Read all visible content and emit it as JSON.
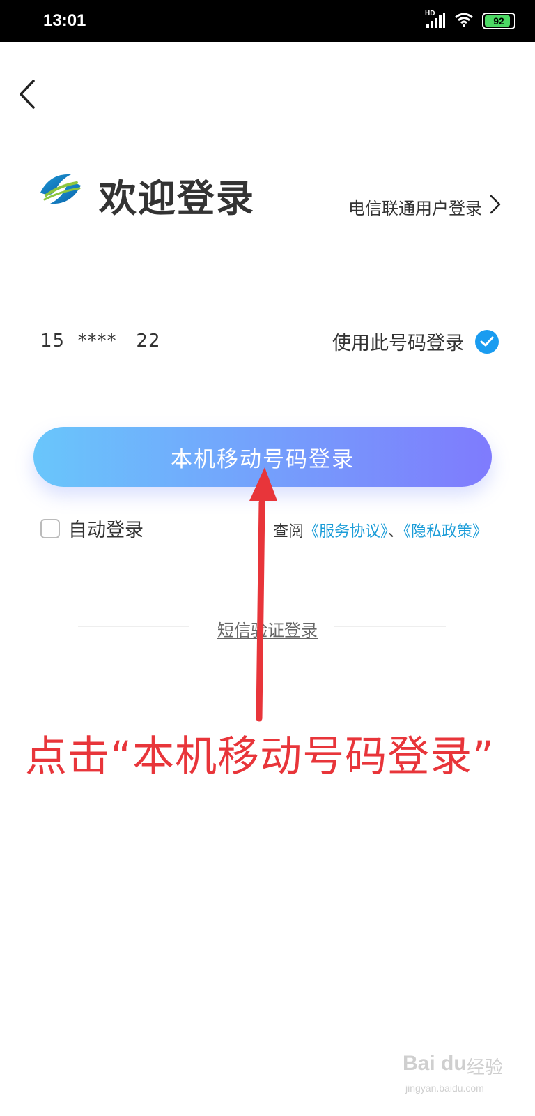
{
  "status_bar": {
    "time": "13:01",
    "network_label": "HD",
    "battery_percent": "92",
    "battery_level": 0.92,
    "icons": [
      "signal-icon",
      "wifi-icon",
      "battery-icon"
    ]
  },
  "header": {
    "back_icon": "chevron-left-icon"
  },
  "brand": {
    "logo": "china-mobile-logo",
    "title": "欢迎登录",
    "alt_login_label": "电信联通用户登录",
    "alt_login_icon": "chevron-right-icon"
  },
  "number_row": {
    "phone_masked": "15  ****   22",
    "use_number_label": "使用此号码登录",
    "checked": true
  },
  "login_button": {
    "label": "本机移动号码登录"
  },
  "auto_login": {
    "label": "自动登录",
    "checked": false
  },
  "agreement": {
    "prefix": "查阅",
    "service_link": "《服务协议》",
    "separator": "、",
    "privacy_link": "《隐私政策》"
  },
  "sms_login": {
    "label": "短信验证登录"
  },
  "annotation": {
    "text": "点击“本机移动号码登录”",
    "color": "#e8353a"
  },
  "watermark": {
    "brand": "Bai du",
    "cn": "经验",
    "site": "jingyan.baidu.com"
  },
  "colors": {
    "button_gradient_start": "#69c6fb",
    "button_gradient_end": "#7f7bfd",
    "link": "#1a9cd8",
    "check": "#1a9cf0"
  }
}
